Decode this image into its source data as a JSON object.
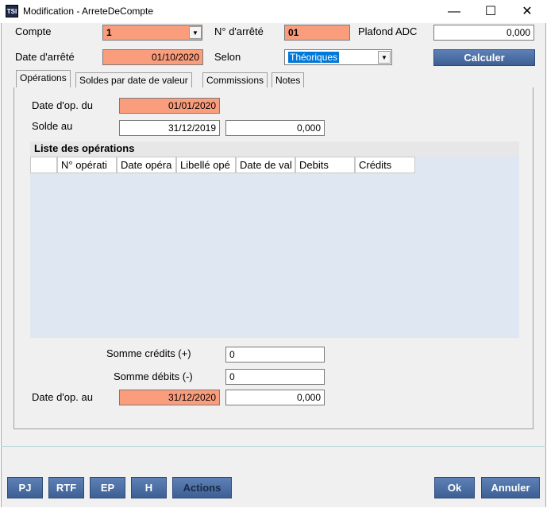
{
  "window": {
    "title": "Modification - ArreteDeCompte",
    "icon": "TSI",
    "minimize": "—",
    "maximize": "☐",
    "close": "✕"
  },
  "header": {
    "compte_label": "Compte",
    "compte_value": "1",
    "numero_label": "N° d'arrêté",
    "numero_value": "01",
    "plafond_label": "Plafond ADC",
    "plafond_value": "0,000",
    "date_arrete_label": "Date d'arrêté",
    "date_arrete_value": "01/10/2020",
    "selon_label": "Selon",
    "selon_value": "Théoriques",
    "calculer_label": "Calculer"
  },
  "tabs": [
    "Opérations",
    "Soldes par date de valeur",
    "Commissions",
    "Notes"
  ],
  "operations": {
    "date_op_du_label": "Date d'op. du",
    "date_op_du_value": "01/01/2020",
    "solde_au_label": "Solde au",
    "solde_au_date": "31/12/2019",
    "solde_au_amount": "0,000",
    "list_title": "Liste des opérations",
    "columns": [
      "",
      "N° opérati",
      "Date opéra",
      "Libellé opé",
      "Date de val",
      "Debits",
      "Crédits"
    ],
    "somme_credits_label": "Somme crédits (+)",
    "somme_credits_value": "0",
    "somme_debits_label": "Somme débits (-)",
    "somme_debits_value": "0",
    "date_op_au_label": "Date d'op. au",
    "date_op_au_value": "31/12/2020",
    "date_op_au_amount": "0,000"
  },
  "footer": {
    "pj": "PJ",
    "rtf": "RTF",
    "ep": "EP",
    "h": "H",
    "actions": "Actions",
    "ok": "Ok",
    "annuler": "Annuler"
  },
  "colors": {
    "required_field": "#fa9d7c",
    "button_blue": "#4a6ea4",
    "list_background": "#dfe7f2"
  }
}
